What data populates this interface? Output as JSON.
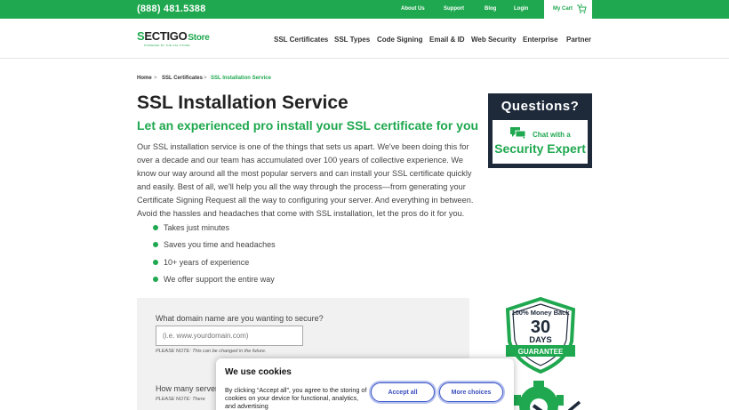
{
  "topbar": {
    "phone": "(888) 481.5388",
    "links": [
      "About Us",
      "Support",
      "Blog",
      "Login"
    ],
    "cart_label": "My Cart",
    "cart_count": "0"
  },
  "logo": {
    "brand_first": "S",
    "brand_rest": "ECTIGO",
    "store": "Store",
    "tagline": "POWERED BY THE SSL STORE"
  },
  "nav": [
    "SSL Certificates",
    "SSL Types",
    "Code Signing",
    "Email & ID",
    "Web Security",
    "Enterprise",
    "Partner"
  ],
  "breadcrumb": [
    "Home",
    "SSL Certificates",
    "SSL Installation Service"
  ],
  "breadcrumb_sep": ">",
  "page": {
    "title": "SSL Installation Service",
    "subtitle": "Let an experienced pro install your SSL certificate for you",
    "intro": "Our SSL installation service is one of the things that sets us apart. We've been doing this for over a decade and our team has accumulated over 100 years of collective experience. We know our way around all the most popular servers and can install your SSL certificate quickly and easily. Best of all, we'll help you all the way through the process—from generating your Certificate Signing Request all the way to configuring your server. And everything in between. Avoid the hassles and headaches that come with SSL installation, let the pros do it for you.",
    "bullets": [
      "Takes just minutes",
      "Saves you time and headaches",
      "10+ years of experience",
      "We offer support the entire way"
    ]
  },
  "form": {
    "domain_label": "What domain name are you wanting to secure?",
    "domain_placeholder": "(i.e. www.yourdomain.com)",
    "domain_note": "PLEASE NOTE: This can be changed in the future.",
    "servers_label": "How many server",
    "servers_note": "PLEASE NOTE: There"
  },
  "sidebar": {
    "questions_title": "Questions?",
    "chat_line1": "Chat with a",
    "chat_line2": "Security Expert",
    "badge_top": "100% Money Back",
    "badge_number": "30",
    "badge_days": "DAYS",
    "badge_ribbon": "GUARANTEE"
  },
  "cookie": {
    "title": "We use cookies",
    "text": "By clicking “Accept all”, you agree to the storing of cookies on your device for functional, analytics, and advertising",
    "accept_label": "Accept all",
    "more_label": "More choices"
  },
  "colors": {
    "brand_green": "#1fa84f",
    "navy": "#1e2a3a",
    "cookie_button": "#3b4fbf"
  }
}
